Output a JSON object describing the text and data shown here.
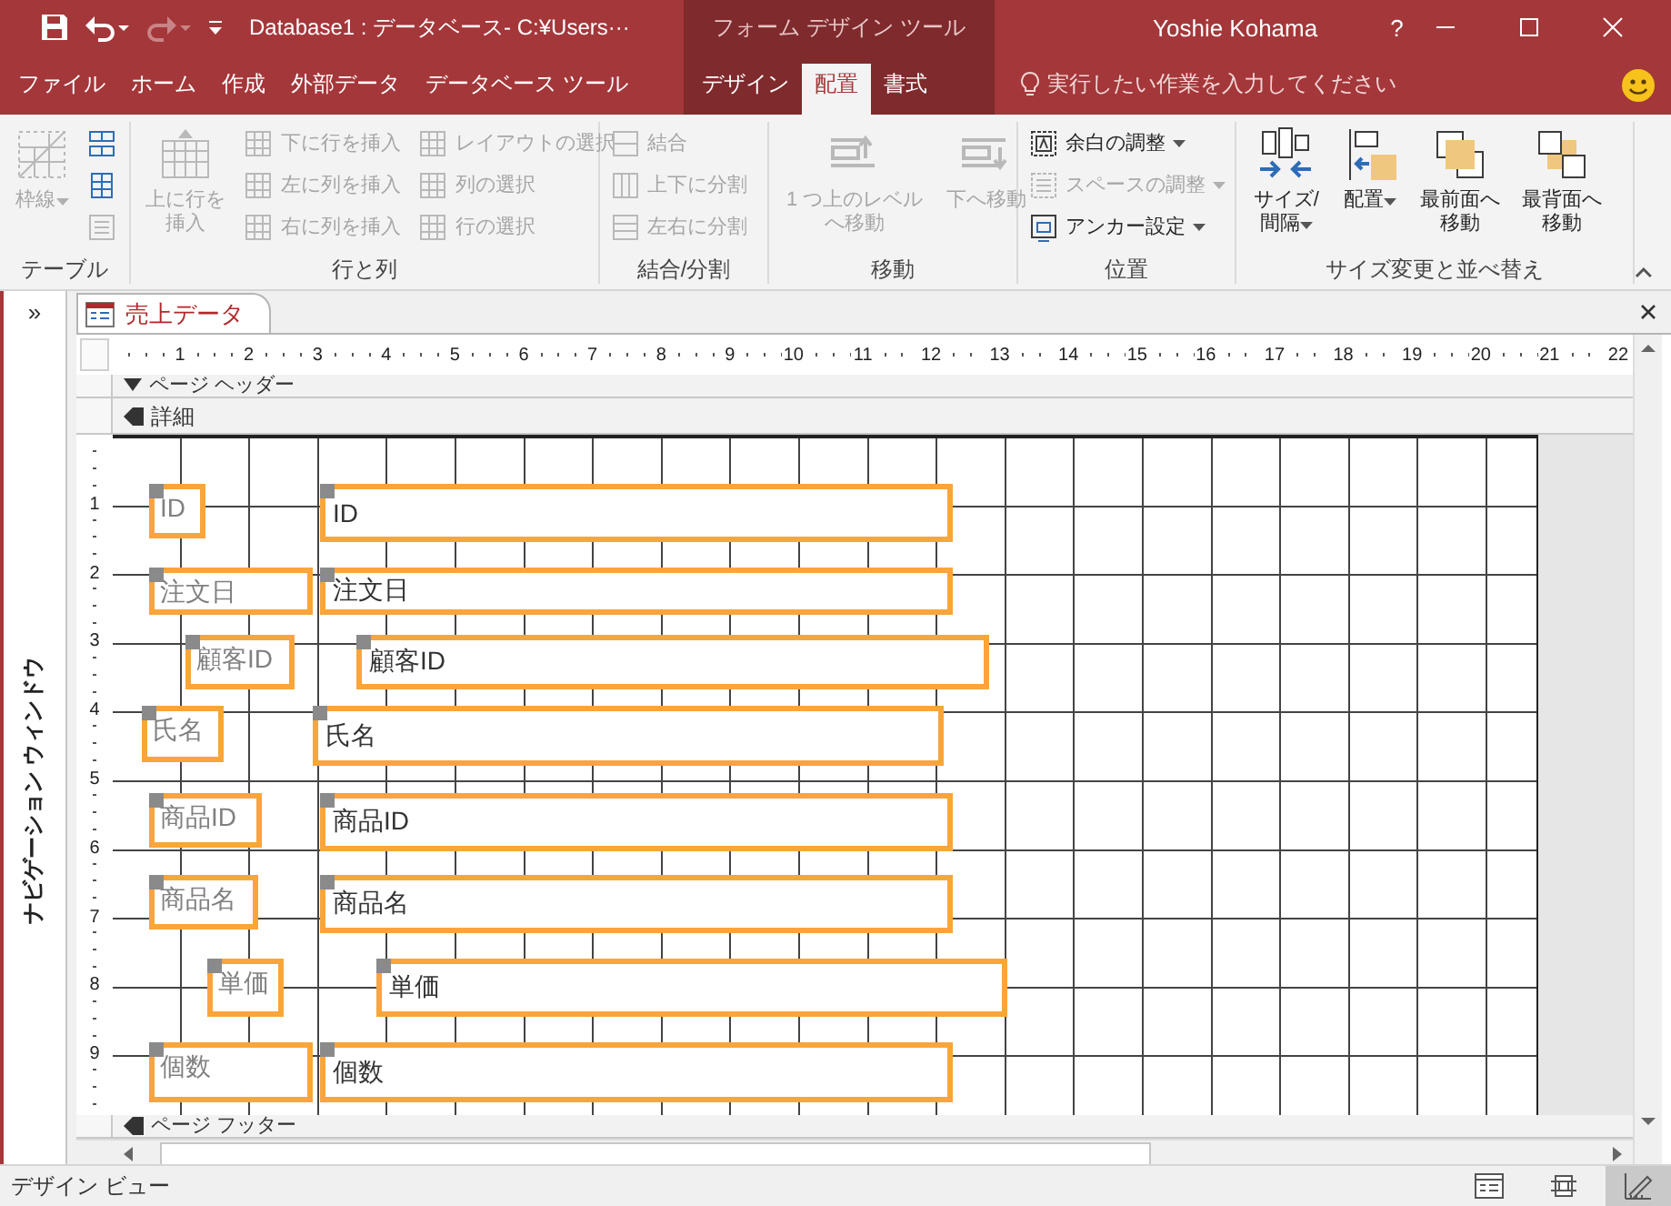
{
  "title_bar": {
    "title": "Database1 : データベース- C:¥Users···",
    "context_group": "フォーム デザイン ツール",
    "user": "Yoshie Kohama",
    "help": "?"
  },
  "quick_access": [
    {
      "kind": "save",
      "disabled": false
    },
    {
      "kind": "undo",
      "disabled": false
    },
    {
      "kind": "redo",
      "disabled": true
    },
    {
      "kind": "customize",
      "disabled": false
    }
  ],
  "tabs": [
    {
      "label": "ファイル",
      "selected": false,
      "contextual": false
    },
    {
      "label": "ホーム",
      "selected": false,
      "contextual": false
    },
    {
      "label": "作成",
      "selected": false,
      "contextual": false
    },
    {
      "label": "外部データ",
      "selected": false,
      "contextual": false
    },
    {
      "label": "データベース ツール",
      "selected": false,
      "contextual": false
    },
    {
      "label": "デザイン",
      "selected": false,
      "contextual": true
    },
    {
      "label": "配置",
      "selected": true,
      "contextual": true
    },
    {
      "label": "書式",
      "selected": false,
      "contextual": true
    }
  ],
  "tell_me": {
    "placeholder": "実行したい作業を入力してください"
  },
  "ribbon_groups": [
    {
      "label": "テーブル",
      "items": [
        {
          "kind": "large",
          "label": "枠線",
          "disabled": true,
          "dropdown": true
        },
        {
          "kind": "icon",
          "disabled": false,
          "dropdown": false
        },
        {
          "kind": "icon",
          "disabled": false,
          "dropdown": false
        },
        {
          "kind": "icon",
          "disabled": true,
          "dropdown": false
        }
      ]
    },
    {
      "label": "行と列",
      "items": [
        {
          "kind": "large",
          "label": "上に行を挿入",
          "disabled": true,
          "dropdown": false
        },
        {
          "kind": "small",
          "label": "下に行を挿入",
          "disabled": true,
          "dropdown": false
        },
        {
          "kind": "small",
          "label": "左に列を挿入",
          "disabled": true,
          "dropdown": false
        },
        {
          "kind": "small",
          "label": "右に列を挿入",
          "disabled": true,
          "dropdown": false
        },
        {
          "kind": "small",
          "label": "レイアウトの選択",
          "disabled": true,
          "dropdown": false
        },
        {
          "kind": "small",
          "label": "列の選択",
          "disabled": true,
          "dropdown": false
        },
        {
          "kind": "small",
          "label": "行の選択",
          "disabled": true,
          "dropdown": false
        }
      ]
    },
    {
      "label": "結合/分割",
      "items": [
        {
          "kind": "small",
          "label": "結合",
          "disabled": true,
          "dropdown": false
        },
        {
          "kind": "small",
          "label": "上下に分割",
          "disabled": true,
          "dropdown": false
        },
        {
          "kind": "small",
          "label": "左右に分割",
          "disabled": true,
          "dropdown": false
        }
      ]
    },
    {
      "label": "移動",
      "items": [
        {
          "kind": "large",
          "label": "1 つ上のレベルへ移動",
          "disabled": true,
          "dropdown": false
        },
        {
          "kind": "large",
          "label": "下へ移動",
          "disabled": true,
          "dropdown": false
        }
      ]
    },
    {
      "label": "位置",
      "items": [
        {
          "kind": "small",
          "label": "余白の調整",
          "disabled": false,
          "dropdown": true
        },
        {
          "kind": "small",
          "label": "スペースの調整",
          "disabled": true,
          "dropdown": true
        },
        {
          "kind": "small",
          "label": "アンカー設定",
          "disabled": false,
          "dropdown": true
        }
      ]
    },
    {
      "label": "サイズ変更と並べ替え",
      "items": [
        {
          "kind": "large",
          "label": "サイズ/間隔",
          "disabled": false,
          "dropdown": true
        },
        {
          "kind": "large",
          "label": "配置",
          "disabled": false,
          "dropdown": true
        },
        {
          "kind": "large",
          "label": "最前面へ移動",
          "disabled": false,
          "dropdown": false
        },
        {
          "kind": "large",
          "label": "最背面へ移動",
          "disabled": false,
          "dropdown": false
        }
      ]
    }
  ],
  "nav_pane": {
    "toggle": "»",
    "title": "ナビゲーション ウィンドウ"
  },
  "document_tab": {
    "title": "売上データ"
  },
  "ruler": {
    "horizontal": [
      "1",
      "2",
      "3",
      "4",
      "5",
      "6",
      "7",
      "8",
      "9",
      "10",
      "11",
      "12",
      "13",
      "14",
      "15",
      "16",
      "17",
      "18",
      "19",
      "20",
      "21",
      "22"
    ],
    "vertical": [
      "1",
      "2",
      "3",
      "4",
      "5",
      "6",
      "7",
      "8",
      "9"
    ]
  },
  "sections": {
    "page_header": "ページ ヘッダー",
    "detail": "詳細",
    "page_footer": "ページ フッター"
  },
  "controls": [
    {
      "label": "ID",
      "field": "ID"
    },
    {
      "label": "注文日",
      "field": "注文日"
    },
    {
      "label": "顧客ID",
      "field": "顧客ID"
    },
    {
      "label": "氏名",
      "field": "氏名"
    },
    {
      "label": "商品ID",
      "field": "商品ID"
    },
    {
      "label": "商品名",
      "field": "商品名"
    },
    {
      "label": "単価",
      "field": "単価"
    },
    {
      "label": "個数",
      "field": "個数"
    }
  ],
  "status_bar": {
    "text": "デザイン ビュー",
    "views": [
      {
        "selected": false
      },
      {
        "selected": false
      },
      {
        "selected": true
      }
    ]
  }
}
